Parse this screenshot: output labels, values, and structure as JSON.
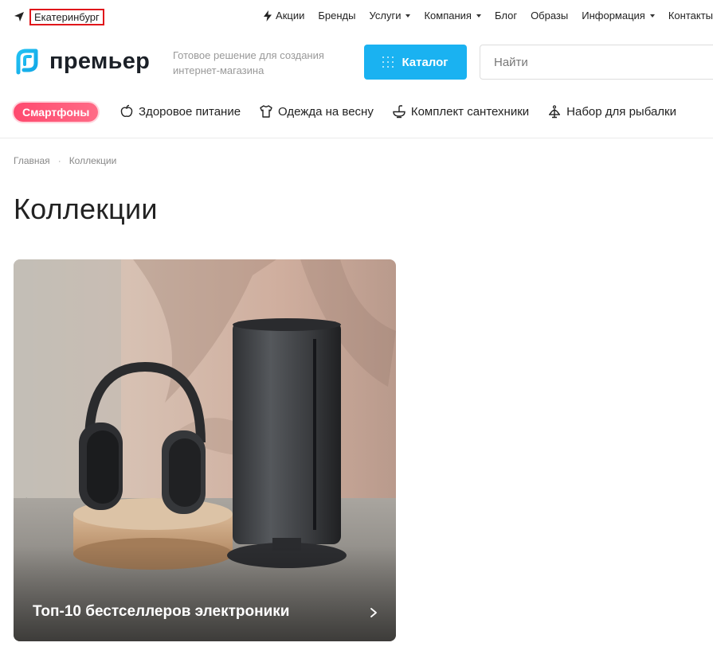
{
  "topbar": {
    "city": "Екатеринбург",
    "nav": [
      {
        "label": "Акции",
        "icon": "bolt-icon",
        "dropdown": false
      },
      {
        "label": "Бренды",
        "dropdown": false
      },
      {
        "label": "Услуги",
        "dropdown": true
      },
      {
        "label": "Компания",
        "dropdown": true
      },
      {
        "label": "Блог",
        "dropdown": false
      },
      {
        "label": "Образы",
        "dropdown": false
      },
      {
        "label": "Информация",
        "dropdown": true
      },
      {
        "label": "Контакты",
        "dropdown": false
      }
    ]
  },
  "header": {
    "logo_text": "премьер",
    "tagline": "Готовое решение для создания интернет-магазина",
    "catalog_label": "Каталог",
    "search_placeholder": "Найти",
    "accent_color": "#1ab2f1"
  },
  "tags": {
    "highlight": "Смартфоны",
    "highlight_color": "#ff4a6f",
    "items": [
      {
        "label": "Здоровое питание",
        "icon": "apple-icon"
      },
      {
        "label": "Одежда на весну",
        "icon": "tshirt-icon"
      },
      {
        "label": "Комплект сантехники",
        "icon": "sink-icon"
      },
      {
        "label": "Набор для рыбалки",
        "icon": "fishing-icon"
      }
    ]
  },
  "breadcrumb": {
    "home": "Главная",
    "current": "Коллекции"
  },
  "page": {
    "title": "Коллекции"
  },
  "collections": [
    {
      "title": "Топ-10 бестселлеров электроники",
      "image": "headphones-and-smart-speaker-photo"
    }
  ]
}
